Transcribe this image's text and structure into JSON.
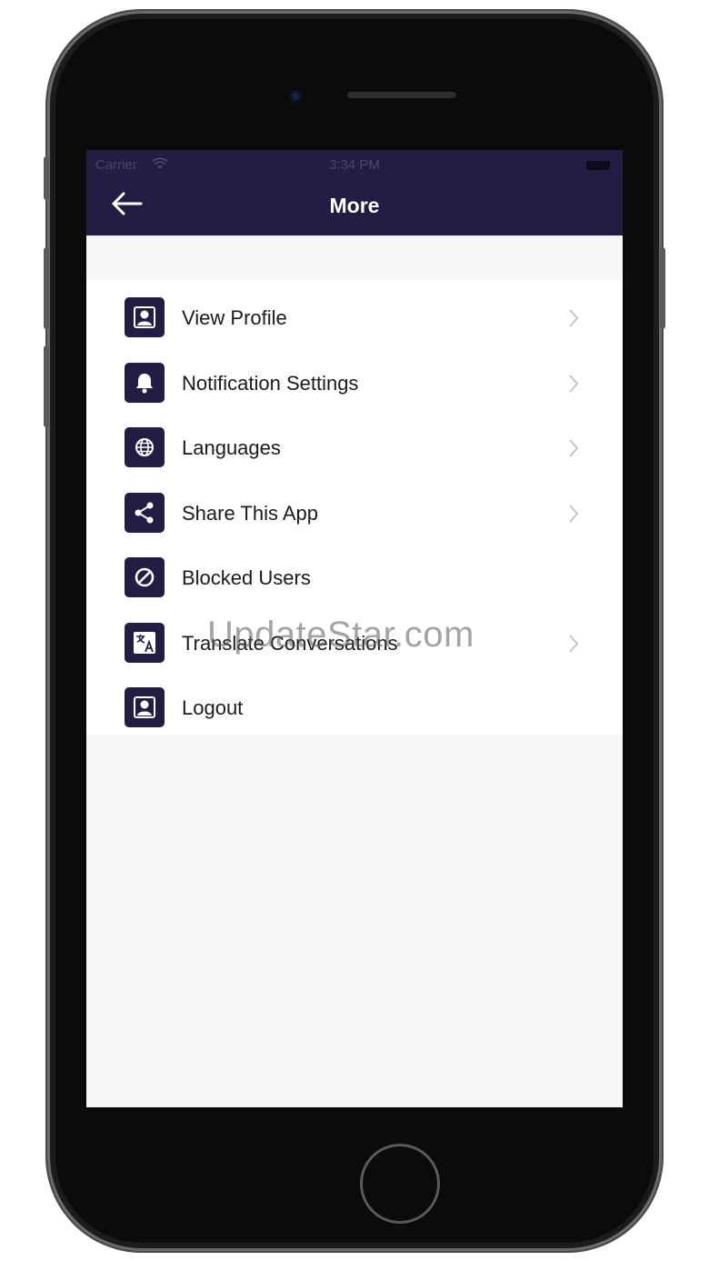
{
  "status_bar": {
    "carrier": "Carrier",
    "time": "3:34 PM"
  },
  "header": {
    "title": "More"
  },
  "menu": {
    "items": [
      {
        "label": "View Profile",
        "icon": "profile-icon",
        "has_chevron": true
      },
      {
        "label": "Notification Settings",
        "icon": "bell-icon",
        "has_chevron": true
      },
      {
        "label": "Languages",
        "icon": "globe-icon",
        "has_chevron": true
      },
      {
        "label": "Share This App",
        "icon": "share-icon",
        "has_chevron": true
      },
      {
        "label": "Blocked Users",
        "icon": "block-icon",
        "has_chevron": false
      },
      {
        "label": "Translate Conversations",
        "icon": "translate-icon",
        "has_chevron": true
      },
      {
        "label": "Logout",
        "icon": "logout-icon",
        "has_chevron": false
      }
    ]
  },
  "watermark": "UpdateStar.com",
  "colors": {
    "header_bg": "#231d43",
    "icon_bg": "#231d43",
    "list_bg": "#ffffff",
    "screen_bg": "#f6f6f6"
  }
}
